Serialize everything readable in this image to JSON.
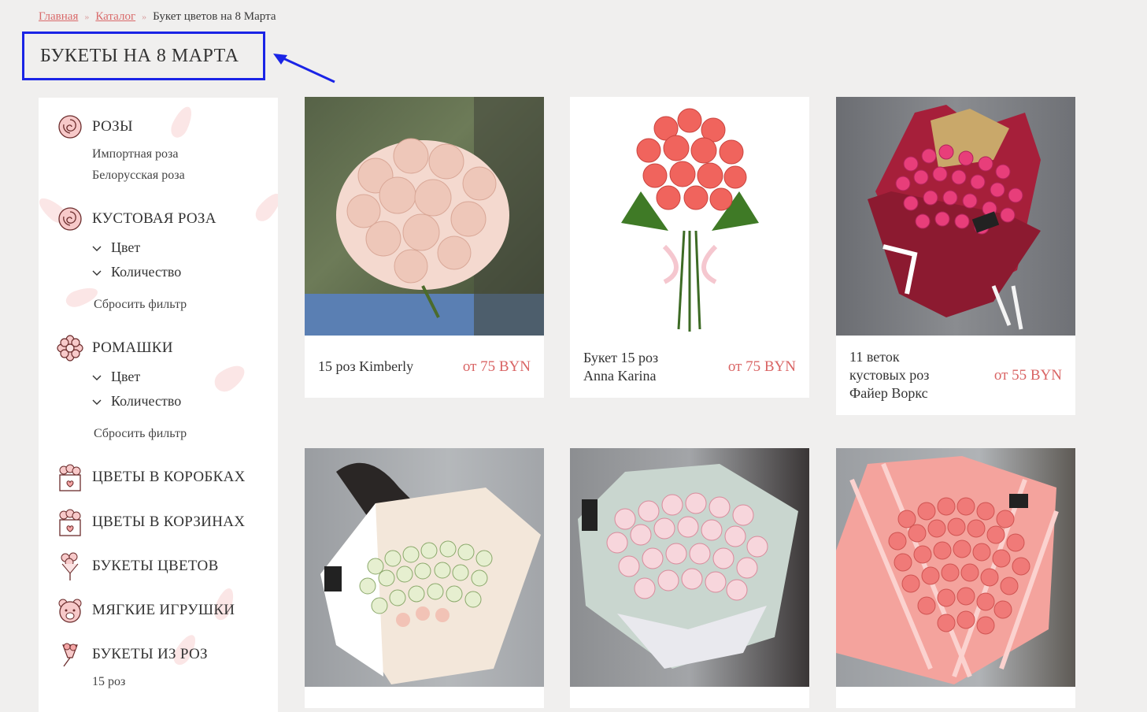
{
  "breadcrumb": {
    "home": "Главная",
    "catalog": "Каталог",
    "current": "Букет цветов на 8 Марта"
  },
  "page_title": "БУКЕТЫ НА 8 МАРТА",
  "sidebar": {
    "roses": {
      "label": "РОЗЫ",
      "subs": [
        "Импортная роза",
        "Белорусская роза"
      ]
    },
    "spray_rose": {
      "label": "КУСТОВАЯ РОЗА",
      "filter_color": "Цвет",
      "filter_qty": "Количество",
      "reset": "Сбросить фильтр"
    },
    "daisies": {
      "label": "РОМАШКИ",
      "filter_color": "Цвет",
      "filter_qty": "Количество",
      "reset": "Сбросить фильтр"
    },
    "boxes": {
      "label": "ЦВЕТЫ В КОРОБКАХ"
    },
    "baskets": {
      "label": "ЦВЕТЫ В КОРЗИНАХ"
    },
    "bouquets": {
      "label": "БУКЕТЫ ЦВЕТОВ"
    },
    "toys": {
      "label": "МЯГКИЕ ИГРУШКИ"
    },
    "rose_bouquets": {
      "label": "БУКЕТЫ ИЗ РОЗ",
      "subs": [
        "15 роз"
      ]
    }
  },
  "products": [
    {
      "name": "15 роз Kimberly",
      "price": "от 75 BYN",
      "icon": "peach-roses-photo"
    },
    {
      "name": "Букет 15 роз Anna Karina",
      "price": "от 75 BYN",
      "icon": "coral-roses-photo"
    },
    {
      "name": "11 веток кустовых роз Файер Воркс",
      "price": "от 55 BYN",
      "icon": "pink-spray-roses-photo"
    },
    {
      "name": "",
      "price": "",
      "icon": "cream-spray-roses-photo"
    },
    {
      "name": "",
      "price": "",
      "icon": "pink-peony-roses-photo"
    },
    {
      "name": "",
      "price": "",
      "icon": "coral-spray-roses-photo"
    }
  ],
  "colors": {
    "accent": "#d96464",
    "highlight": "#1a24e6",
    "background": "#f0efee"
  }
}
